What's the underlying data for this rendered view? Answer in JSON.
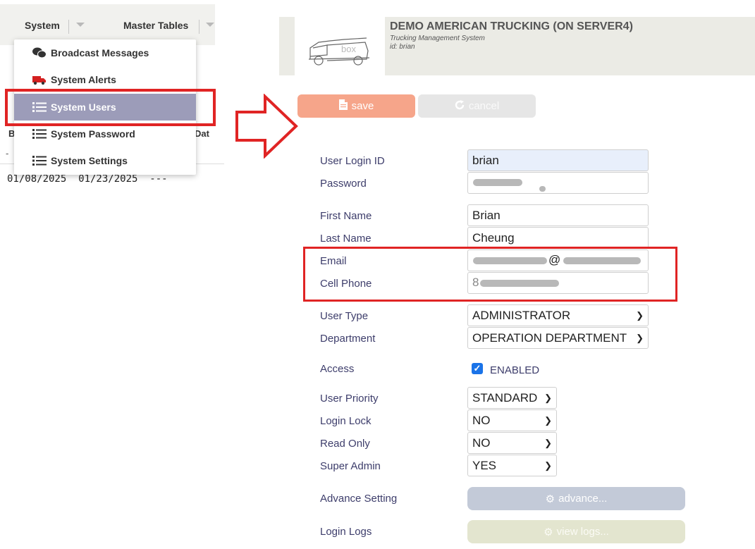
{
  "menubar": {
    "system": "System",
    "master_tables": "Master Tables"
  },
  "dropdown": {
    "items": [
      {
        "label": "Broadcast Messages",
        "icon": "chat-bubbles-icon"
      },
      {
        "label": "System Alerts",
        "icon": "truck-icon"
      },
      {
        "label": "System Users",
        "icon": "list-icon",
        "active": true
      },
      {
        "label": "System Password",
        "icon": "list-icon"
      },
      {
        "label": "System Settings",
        "icon": "list-icon"
      }
    ]
  },
  "behind_table": {
    "col_b": "B",
    "col_date": "Dat",
    "dash": "-",
    "row": "01/08/2025  01/23/2025  ---"
  },
  "header": {
    "company": "DEMO AMERICAN TRUCKING (ON SERVER4)",
    "subtitle": "Trucking Management System",
    "user_id": "id: brian",
    "logo_text": "box"
  },
  "toolbar": {
    "save_label": "save",
    "cancel_label": "cancel"
  },
  "form": {
    "login_id_label": "User Login ID",
    "login_id_value": "brian",
    "password_label": "Password",
    "first_name_label": "First Name",
    "first_name_value": "Brian",
    "last_name_label": "Last Name",
    "last_name_value": "Cheung",
    "email_label": "Email",
    "email_value": "@",
    "cell_label": "Cell Phone",
    "cell_value": "8",
    "user_type_label": "User Type",
    "user_type_value": "ADMINISTRATOR",
    "department_label": "Department",
    "department_value": "OPERATION DEPARTMENT",
    "access_label": "Access",
    "access_value": "ENABLED",
    "priority_label": "User Priority",
    "priority_value": "STANDARD",
    "login_lock_label": "Login Lock",
    "login_lock_value": "NO",
    "read_only_label": "Read Only",
    "read_only_value": "NO",
    "super_admin_label": "Super Admin",
    "super_admin_value": "YES",
    "advance_label": "Advance Setting",
    "advance_button": "advance...",
    "logs_label": "Login Logs",
    "logs_button": "view logs..."
  },
  "colors": {
    "accent_red": "#e02424",
    "save_button": "#f6a58a",
    "menu_active": "#9c9cb9",
    "label_text": "#3d3d6b"
  }
}
